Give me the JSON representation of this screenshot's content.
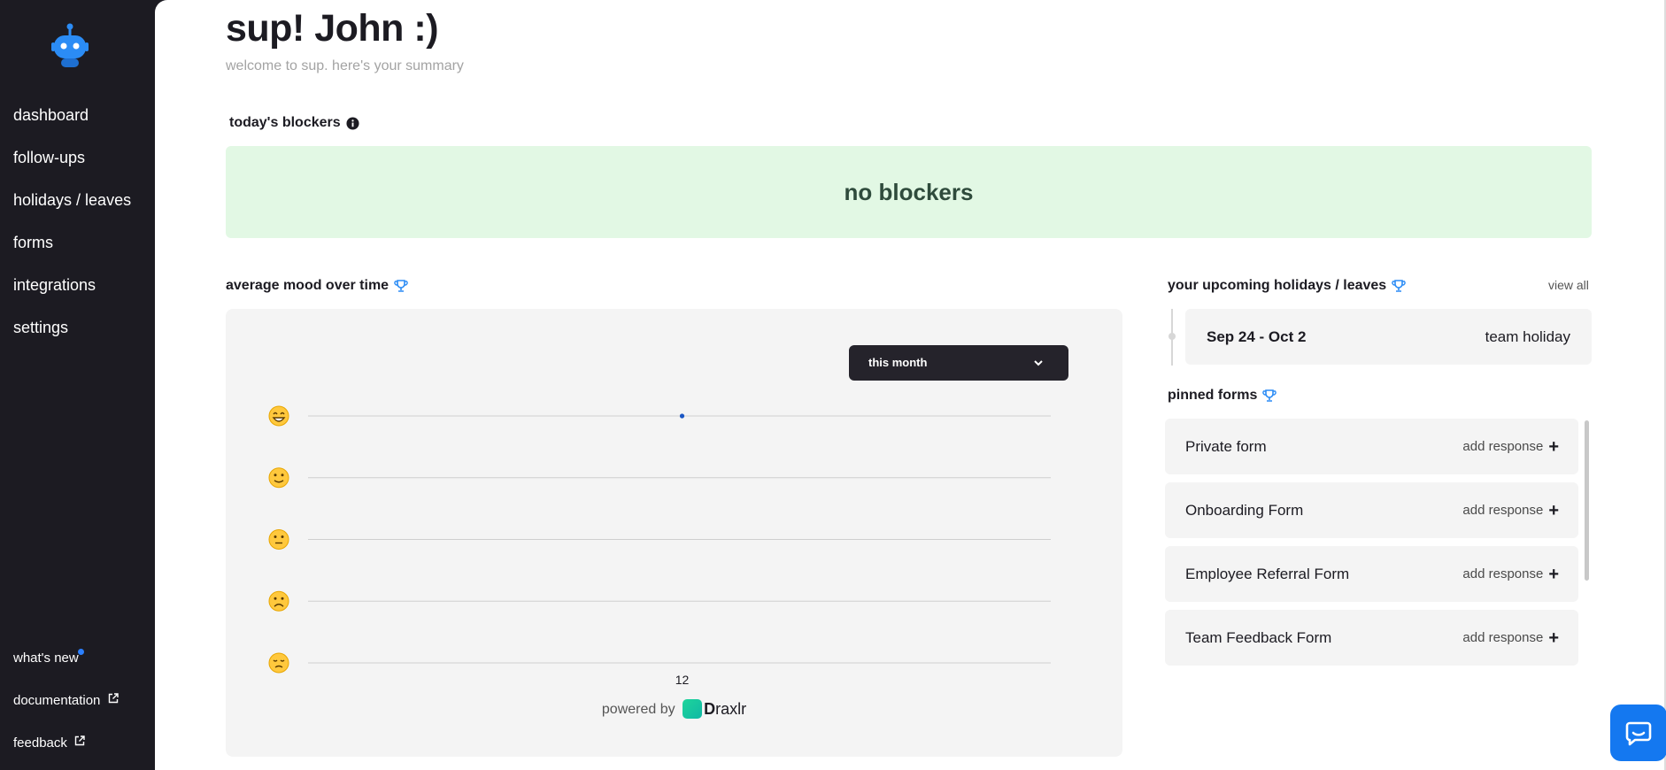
{
  "sidebar": {
    "nav": [
      {
        "label": "dashboard"
      },
      {
        "label": "follow-ups"
      },
      {
        "label": "holidays / leaves"
      },
      {
        "label": "forms"
      },
      {
        "label": "integrations"
      },
      {
        "label": "settings"
      }
    ],
    "bottom": {
      "whats_new": "what's new",
      "documentation": "documentation",
      "feedback": "feedback"
    }
  },
  "header": {
    "title": "sup! John :)",
    "subtitle": "welcome to sup. here's your summary"
  },
  "blockers": {
    "title": "today's blockers",
    "message": "no blockers"
  },
  "mood": {
    "title": "average mood over time",
    "period": "this month",
    "x_tick": "12",
    "powered_prefix": "powered by",
    "brand_first": "D",
    "brand_rest": "raxlr"
  },
  "chart_data": {
    "type": "scatter",
    "title": "average mood over time",
    "x": [
      "12"
    ],
    "y_levels": [
      "grinning",
      "slightly-smiling",
      "neutral",
      "frowning",
      "tired"
    ],
    "series": [
      {
        "values": [
          5
        ]
      }
    ],
    "ylim": [
      1,
      5
    ],
    "grid": true
  },
  "holidays": {
    "title": "your upcoming holidays / leaves",
    "view_all": "view all",
    "items": [
      {
        "dates": "Sep 24 - Oct 2",
        "type": "team holiday"
      }
    ]
  },
  "pinned_forms": {
    "title": "pinned forms",
    "add_label": "add response",
    "items": [
      {
        "name": "Private form"
      },
      {
        "name": "Onboarding Form"
      },
      {
        "name": "Employee Referral Form"
      },
      {
        "name": "Team Feedback Form"
      }
    ]
  },
  "colors": {
    "sidebar": "#1c1b22",
    "accent": "#1478f0",
    "blockers_bg": "#e2f8e4",
    "card_bg": "#f4f4f4",
    "mood_point": "#1a56c4"
  },
  "icons": {
    "logo": "robot-logo-icon",
    "info": "info-icon",
    "trophy": "trophy-icon",
    "external": "external-link-icon",
    "chevron": "chevron-down-icon",
    "plus": "plus-icon",
    "chat": "chat-bubble-icon"
  }
}
